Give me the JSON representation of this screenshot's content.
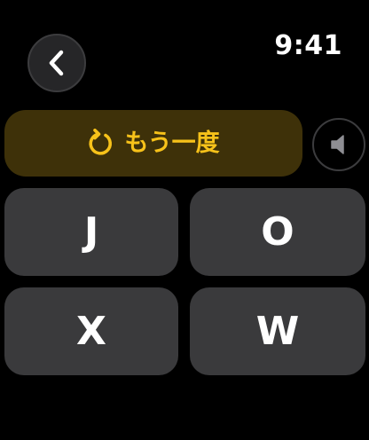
{
  "status_bar": {
    "time": "9:41"
  },
  "navigation": {
    "back_icon": "chevron-left-icon"
  },
  "replay": {
    "label": "もう一度",
    "icon": "replay-icon",
    "accent_color": "#f7c21a",
    "background_color": "#3e3109"
  },
  "audio": {
    "icon": "speaker-icon"
  },
  "answers": [
    {
      "letter": "J"
    },
    {
      "letter": "O"
    },
    {
      "letter": "X"
    },
    {
      "letter": "W"
    }
  ],
  "colors": {
    "background": "#000000",
    "tile": "#3a3a3c"
  }
}
